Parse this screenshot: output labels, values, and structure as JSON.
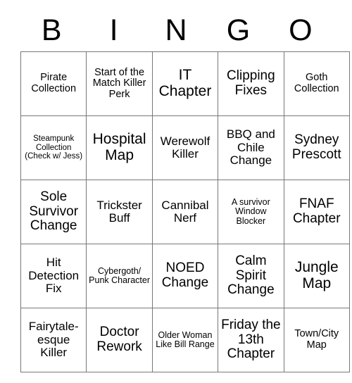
{
  "card": {
    "header_letters": [
      "B",
      "I",
      "N",
      "G",
      "O"
    ],
    "colors": {
      "border": "#777777",
      "text": "#000000",
      "background": "#ffffff"
    },
    "rows": [
      [
        {
          "text": "Pirate Collection",
          "size": "sm"
        },
        {
          "text": "Start of the Match Killer Perk",
          "size": "sm"
        },
        {
          "text": "IT Chapter",
          "size": "xl"
        },
        {
          "text": "Clipping Fixes",
          "size": "lg"
        },
        {
          "text": "Goth Collection",
          "size": "sm"
        }
      ],
      [
        {
          "text": "Steampunk Collection (Check w/ Jess)",
          "size": "xxs"
        },
        {
          "text": "Hospital Map",
          "size": "xl"
        },
        {
          "text": "Werewolf Killer",
          "size": "md"
        },
        {
          "text": "BBQ and Chile Change",
          "size": "md"
        },
        {
          "text": "Sydney Prescott",
          "size": "lg"
        }
      ],
      [
        {
          "text": "Sole Survivor Change",
          "size": "lg"
        },
        {
          "text": "Trickster Buff",
          "size": "md"
        },
        {
          "text": "Cannibal Nerf",
          "size": "md"
        },
        {
          "text": "A survivor Window Blocker",
          "size": "xs"
        },
        {
          "text": "FNAF Chapter",
          "size": "lg"
        }
      ],
      [
        {
          "text": "Hit Detection Fix",
          "size": "md"
        },
        {
          "text": "Cybergoth/ Punk Character",
          "size": "xs"
        },
        {
          "text": "NOED Change",
          "size": "lg"
        },
        {
          "text": "Calm Spirit Change",
          "size": "lg"
        },
        {
          "text": "Jungle Map",
          "size": "xl"
        }
      ],
      [
        {
          "text": "Fairytale-esque Killer",
          "size": "md"
        },
        {
          "text": "Doctor Rework",
          "size": "lg"
        },
        {
          "text": "Older Woman Like Bill Range",
          "size": "xs"
        },
        {
          "text": "Friday the 13th Chapter",
          "size": "lg"
        },
        {
          "text": "Town/City Map",
          "size": "sm"
        }
      ]
    ]
  }
}
